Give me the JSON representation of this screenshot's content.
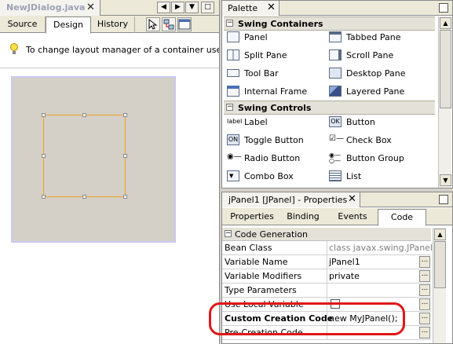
{
  "editor": {
    "doc_tab": "NewJDialog.java",
    "mode_tabs": [
      "Source",
      "Design",
      "History"
    ],
    "active_mode": "Design",
    "hint": "To change layout manager of a container use Set L"
  },
  "palette": {
    "title": "Palette",
    "categories": [
      {
        "name": "Swing Containers",
        "items": [
          {
            "label": "Panel",
            "icon": "panel-icon"
          },
          {
            "label": "Tabbed Pane",
            "icon": "tabbed-pane-icon"
          },
          {
            "label": "Split Pane",
            "icon": "split-pane-icon"
          },
          {
            "label": "Scroll Pane",
            "icon": "scroll-pane-icon"
          },
          {
            "label": "Tool Bar",
            "icon": "tool-bar-icon"
          },
          {
            "label": "Desktop Pane",
            "icon": "desktop-pane-icon"
          },
          {
            "label": "Internal Frame",
            "icon": "internal-frame-icon"
          },
          {
            "label": "Layered Pane",
            "icon": "layered-pane-icon"
          }
        ]
      },
      {
        "name": "Swing Controls",
        "items": [
          {
            "label": "Label",
            "icon": "label-icon"
          },
          {
            "label": "Button",
            "icon": "button-icon"
          },
          {
            "label": "Toggle Button",
            "icon": "toggle-button-icon"
          },
          {
            "label": "Check Box",
            "icon": "check-box-icon"
          },
          {
            "label": "Radio Button",
            "icon": "radio-button-icon"
          },
          {
            "label": "Button Group",
            "icon": "button-group-icon"
          },
          {
            "label": "Combo Box",
            "icon": "combo-box-icon"
          },
          {
            "label": "List",
            "icon": "list-icon"
          }
        ]
      }
    ]
  },
  "properties": {
    "title": "jPanel1 [JPanel] - Properties",
    "tabs": [
      "Properties",
      "Binding",
      "Events",
      "Code"
    ],
    "active_tab": "Code",
    "section": "Code Generation",
    "rows": [
      {
        "name": "Bean Class",
        "value": "class javax.swing.JPanel",
        "button": false
      },
      {
        "name": "Variable Name",
        "value": "jPanel1",
        "button": true
      },
      {
        "name": "Variable Modifiers",
        "value": "private",
        "button": true
      },
      {
        "name": "Type Parameters",
        "value": "",
        "button": true
      },
      {
        "name": "Use Local Variable",
        "value": "",
        "button": true
      },
      {
        "name": "Custom Creation Code",
        "value": "new MyJPanel();",
        "button": true
      },
      {
        "name": "Pre-Creation Code",
        "value": "",
        "button": true
      }
    ]
  },
  "colors": {
    "highlight": "#e01818",
    "selection": "#f0a020"
  }
}
